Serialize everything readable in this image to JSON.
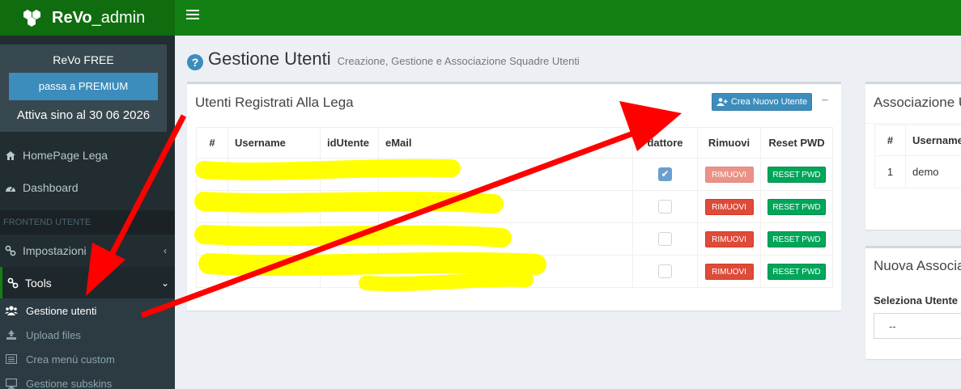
{
  "app": {
    "brand_bold": "ReVo",
    "brand_rest": "_admin"
  },
  "promo": {
    "title": "ReVo FREE",
    "button": "passa a PREMIUM",
    "subtitle": "Attiva sino al 30 06 2026"
  },
  "sidebar": {
    "items": [
      {
        "label": "HomePage Lega",
        "icon": "home-icon"
      },
      {
        "label": "Dashboard",
        "icon": "dashboard-icon"
      }
    ],
    "section_header": "FRONTEND UTENTE",
    "menus": [
      {
        "label": "Impostazioni",
        "icon": "link-icon",
        "chevron": "‹"
      },
      {
        "label": "Tools",
        "icon": "link-icon",
        "chevron": "⌄"
      }
    ],
    "submenu": [
      {
        "label": "Gestione utenti",
        "icon": "users-icon",
        "active": true
      },
      {
        "label": "Upload files",
        "icon": "upload-icon"
      },
      {
        "label": "Crea menù custom",
        "icon": "list-icon"
      },
      {
        "label": "Gestione subskins",
        "icon": "desktop-icon"
      }
    ]
  },
  "page": {
    "title": "Gestione Utenti",
    "subtitle": "Creazione, Gestione e Associazione Squadre Utenti"
  },
  "users_box": {
    "title": "Utenti Registrati Alla Lega",
    "create_button": "Crea Nuovo Utente",
    "columns": [
      "#",
      "Username",
      "idUtente",
      "eMail",
      "dattore",
      "Rimuovi",
      "Reset PWD"
    ],
    "rows": [
      {
        "checked": true,
        "remove": "RIMUOVI",
        "remove_disabled": true,
        "reset": "RESET PWD"
      },
      {
        "checked": false,
        "remove": "RIMUOVI",
        "remove_disabled": false,
        "reset": "RESET PWD"
      },
      {
        "checked": false,
        "remove": "RIMUOVI",
        "remove_disabled": false,
        "reset": "RESET PWD"
      },
      {
        "checked": false,
        "remove": "RIMUOVI",
        "remove_disabled": false,
        "reset": "RESET PWD"
      }
    ]
  },
  "assoc_box": {
    "title": "Associazione U",
    "columns": [
      "#",
      "Username"
    ],
    "rows": [
      {
        "n": "1",
        "username": "demo"
      }
    ]
  },
  "new_assoc_box": {
    "title": "Nuova Associa",
    "label": "Seleziona Utente",
    "select_value": "--"
  },
  "colors": {
    "topbar": "#138013",
    "sidebar": "#222d32",
    "primary": "#3c8dbc",
    "danger": "#dd4b39",
    "success": "#00a65a",
    "annotation_arrow": "#ff0000",
    "redaction": "#ffff00"
  }
}
